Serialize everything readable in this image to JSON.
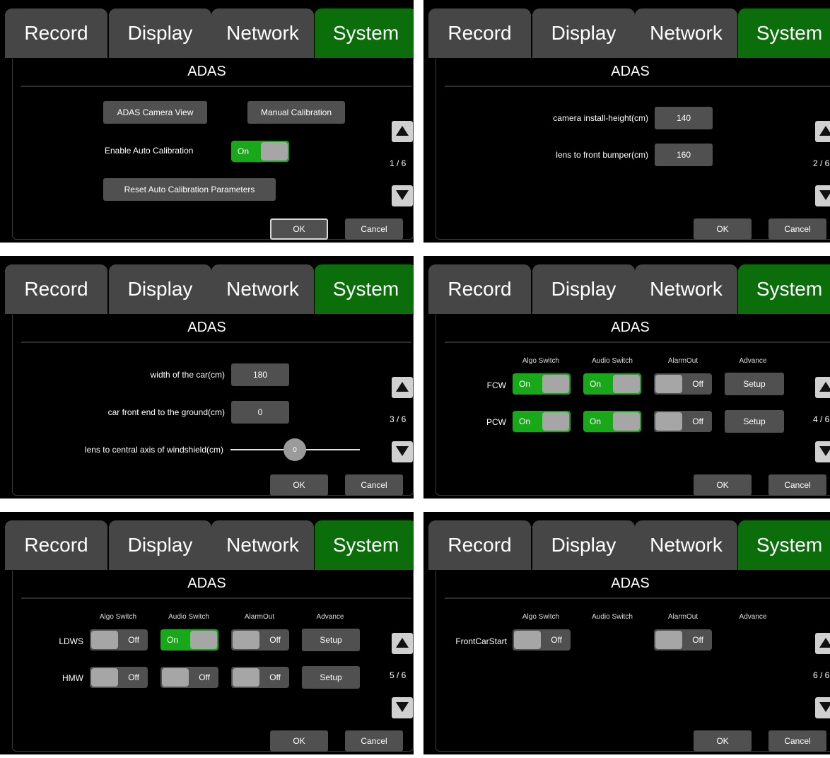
{
  "tabs": [
    "Record",
    "Display",
    "Network",
    "System"
  ],
  "title": "ADAS",
  "arrows": {
    "up": "up-arrow-icon",
    "down": "down-arrow-icon"
  },
  "footer": {
    "ok": "OK",
    "cancel": "Cancel"
  },
  "colors": {
    "active_tab": "#0b6e0b",
    "toggle_on": "#19a819",
    "button": "#505050"
  },
  "screen1": {
    "camera_view": "ADAS Camera View",
    "manual_calibration": "Manual Calibration",
    "enable_auto_label": "Enable Auto Calibration",
    "enable_auto_state": "On",
    "reset": "Reset Auto Calibration Parameters",
    "page": "1 / 6"
  },
  "screen2": {
    "install_height_label": "camera install-height(cm)",
    "install_height_value": "140",
    "bumper_label": "lens to front bumper(cm)",
    "bumper_value": "160",
    "page": "2 / 6"
  },
  "screen3": {
    "width_label": "width of the car(cm)",
    "width_value": "180",
    "ground_label": "car front end to the ground(cm)",
    "ground_value": "0",
    "axis_label": "lens to central axis of windshield(cm)",
    "axis_value": "0",
    "page": "3 / 6"
  },
  "headers": {
    "algo": "Algo Switch",
    "audio": "Audio Switch",
    "alarm": "AlarmOut",
    "advance": "Advance"
  },
  "screen4": {
    "rows": [
      {
        "name": "FCW",
        "algo": "On",
        "audio": "On",
        "alarm": "Off",
        "advance": "Setup"
      },
      {
        "name": "PCW",
        "algo": "On",
        "audio": "On",
        "alarm": "Off",
        "advance": "Setup"
      }
    ],
    "page": "4 / 6"
  },
  "screen5": {
    "rows": [
      {
        "name": "LDWS",
        "algo": "Off",
        "audio": "On",
        "alarm": "Off",
        "advance": "Setup"
      },
      {
        "name": "HMW",
        "algo": "Off",
        "audio": "Off",
        "alarm": "Off",
        "advance": "Setup"
      }
    ],
    "page": "5 / 6"
  },
  "screen6": {
    "rows": [
      {
        "name": "FrontCarStart",
        "algo": "Off",
        "alarm": "Off"
      }
    ],
    "page": "6 / 6"
  }
}
